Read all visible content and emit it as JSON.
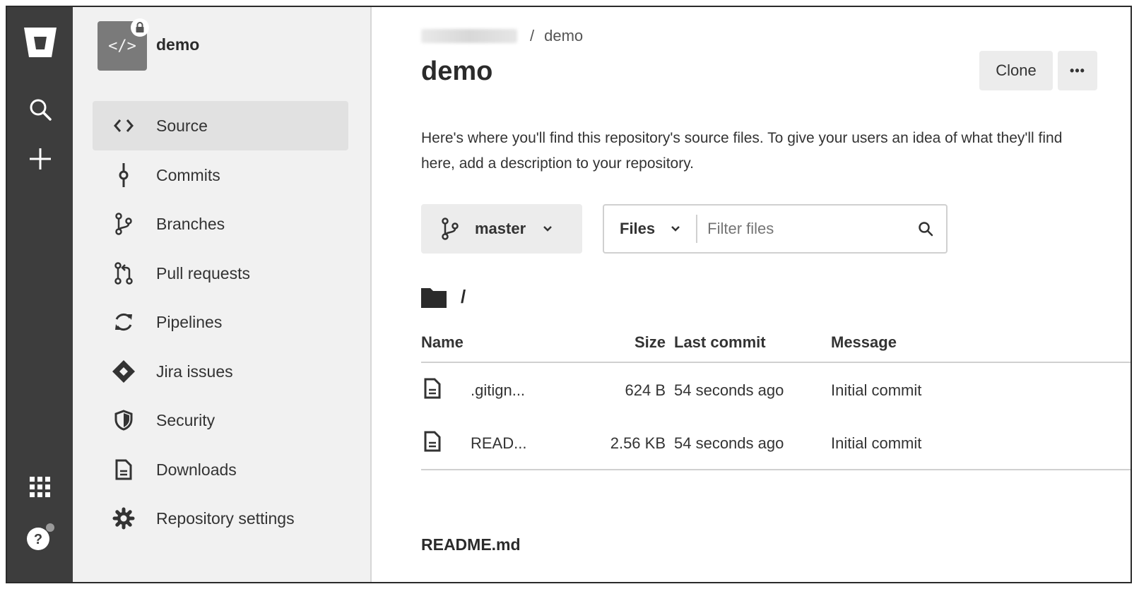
{
  "global_nav": {
    "icons": [
      "bitbucket-logo",
      "search-icon",
      "plus-icon",
      "apps-grid-icon",
      "help-icon"
    ]
  },
  "sidebar": {
    "repo_name": "demo",
    "repo_avatar_glyph": "</>",
    "items": [
      {
        "label": "Source",
        "icon": "source-icon",
        "active": true
      },
      {
        "label": "Commits",
        "icon": "commits-icon"
      },
      {
        "label": "Branches",
        "icon": "branches-icon"
      },
      {
        "label": "Pull requests",
        "icon": "pull-requests-icon"
      },
      {
        "label": "Pipelines",
        "icon": "pipelines-icon"
      },
      {
        "label": "Jira issues",
        "icon": "jira-icon"
      },
      {
        "label": "Security",
        "icon": "shield-icon"
      },
      {
        "label": "Downloads",
        "icon": "downloads-icon"
      },
      {
        "label": "Repository settings",
        "icon": "gear-icon"
      }
    ]
  },
  "header": {
    "breadcrumb_sep": "/",
    "breadcrumb_repo": "demo",
    "title": "demo",
    "clone_label": "Clone",
    "more_label": "•••"
  },
  "description": "Here's where you'll find this repository's source files. To give your users an idea of what they'll find here, add a description to your repository.",
  "toolbar": {
    "branch": "master",
    "scope": "Files",
    "filter_placeholder": "Filter files"
  },
  "path": "/",
  "table": {
    "columns": [
      "Name",
      "Size",
      "Last commit",
      "Message"
    ],
    "rows": [
      {
        "name": ".gitign...",
        "size": "624 B",
        "last_commit": "54 seconds ago",
        "message": "Initial commit"
      },
      {
        "name": "READ...",
        "size": "2.56 KB",
        "last_commit": "54 seconds ago",
        "message": "Initial commit"
      }
    ]
  },
  "readme_title": "README.md"
}
